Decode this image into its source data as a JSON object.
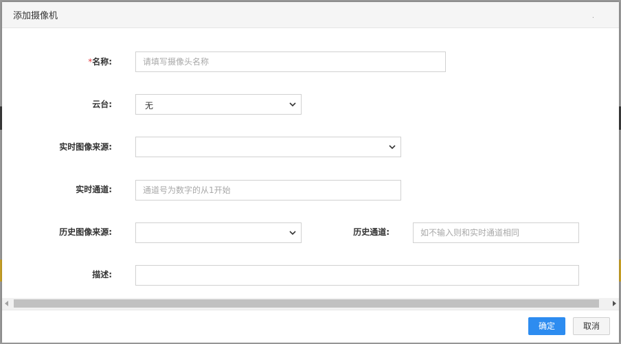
{
  "dialog": {
    "title": "添加摄像机",
    "close_glyph": "."
  },
  "form": {
    "name": {
      "required_mark": "*",
      "label": "名称:",
      "placeholder": "请填写摄像头名称",
      "value": ""
    },
    "ptz": {
      "label": "云台:",
      "selected": "无"
    },
    "realtime_source": {
      "label": "实时图像来源:",
      "selected": ""
    },
    "realtime_channel": {
      "label": "实时通道:",
      "placeholder": "通道号为数字的从1开始",
      "value": ""
    },
    "history_source": {
      "label": "历史图像来源:",
      "selected": ""
    },
    "history_channel": {
      "label": "历史通道:",
      "placeholder": "如不输入则和实时通道相同",
      "value": ""
    },
    "description": {
      "label": "描述:",
      "value": ""
    }
  },
  "footer": {
    "ok_label": "确定",
    "cancel_label": "取消"
  },
  "colors": {
    "primary": "#2d8cf0",
    "required": "#e4393c"
  },
  "icons": {
    "dropdown": "chevron-down-icon",
    "scroll_left": "arrow-left-icon",
    "scroll_right": "arrow-right-icon"
  }
}
